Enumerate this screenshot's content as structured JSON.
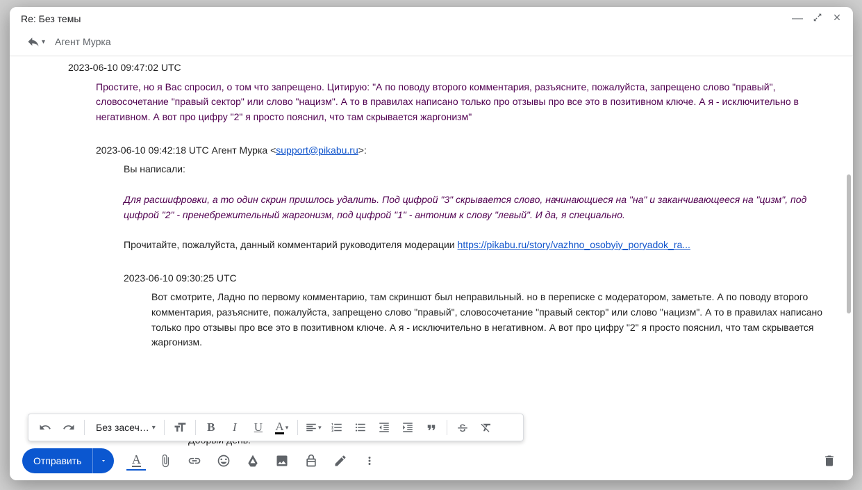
{
  "window_title": "Re: Без темы",
  "recipient": "Агент Мурка",
  "messages": {
    "m1": {
      "timestamp": "2023-06-10 09:47:02 UTC",
      "text": "Простите, но я Вас спросил, о том что запрещено.  Цитирую: \"А по поводу второго комментария, разъясните, пожалуйста, запрещено слово \"правый\", словосочетание \"правый сектор\" или слово \"нацизм\". А то в правилах написано только про отзывы про все это в позитивном ключе. А я - исключительно в негативном. А вот про цифру \"2\" я просто пояснил, что там скрывается жаргонизм\""
    },
    "m2": {
      "header_prefix": "2023-06-10 09:42:18 UTC Агент Мурка <",
      "email": "support@pikabu.ru",
      "header_suffix": ">:",
      "you_wrote": "Вы написали:",
      "italic_text": "Для расшифровки, а то один скрин пришлось удалить. Под цифрой \"3\" скрывается слово, начинающиеся на \"на\" и заканчивающееся на \"цизм\", под цифрой \"2\" - пренебрежительный жаргонизм, под цифрой \"1\" - антоним к слову \"левый\". И да, я специально.",
      "read_prefix": "Прочитайте, пожалуйста, данный комментарий руководителя модерации ",
      "link_text": "https://pikabu.ru/story/vazhno_osobyiy_poryadok_ra..."
    },
    "m3": {
      "timestamp": "2023-06-10 09:30:25 UTC",
      "text": "Вот смотрите, Ладно по первому комментарию, там скриншот был неправильный. но в переписке с модератором, заметьте. А по поводу второго комментария, разъясните, пожалуйста, запрещено слово \"правый\", словосочетание \"правый сектор\" или слово \"нацизм\". А то в правилах написано только про отзывы про все это в позитивном ключе. А я - исключительно в негативном. А вот про цифру \"2\" я просто пояснил, что там скрывается жаргонизм."
    }
  },
  "partial_line": "Добрый день.",
  "toolbar": {
    "font_label": "Без засеч…",
    "send_label": "Отправить"
  }
}
